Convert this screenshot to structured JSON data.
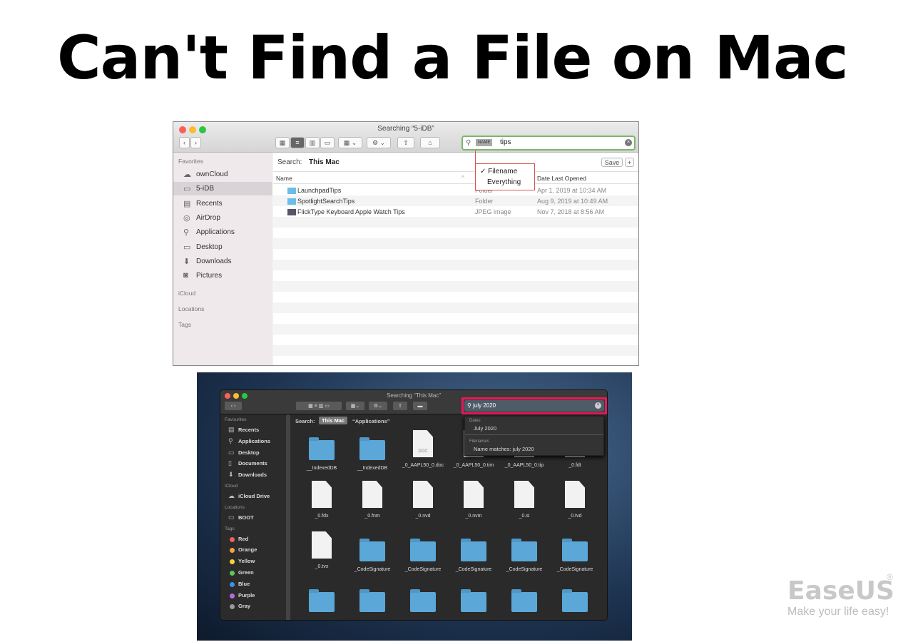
{
  "title": "Can't Find a File on Mac",
  "light": {
    "window_title": "Searching “5-iDB”",
    "search_token": "NAME",
    "search_text": "tips",
    "menu": [
      "✓ Filename",
      "Everything"
    ],
    "scope_label": "Search:",
    "scope": "This Mac",
    "save": "Save",
    "plus": "+",
    "col_name": "Name",
    "col_date": "Date Last Opened",
    "sidebar_headers": [
      "Favorites",
      "iCloud",
      "Locations",
      "Tags"
    ],
    "sidebar": [
      {
        "label": "ownCloud",
        "icon": "☁"
      },
      {
        "label": "5-iDB",
        "icon": "▭",
        "selected": true
      },
      {
        "label": "Recents",
        "icon": "▤"
      },
      {
        "label": "AirDrop",
        "icon": "◎"
      },
      {
        "label": "Applications",
        "icon": "⚲"
      },
      {
        "label": "Desktop",
        "icon": "▭"
      },
      {
        "label": "Downloads",
        "icon": "⬇"
      },
      {
        "label": "Pictures",
        "icon": "◙"
      }
    ],
    "rows": [
      {
        "name": "LaunchpadTips",
        "kind": "Folder",
        "date": "Apr 1, 2019 at 10:34 AM",
        "icon": "folder"
      },
      {
        "name": "SpotlightSearchTips",
        "kind": "Folder",
        "date": "Aug 9, 2019 at 10:49 AM",
        "icon": "folder"
      },
      {
        "name": "FlickType Keyboard Apple Watch Tips",
        "kind": "JPEG image",
        "date": "Nov 7, 2018 at 8:56 AM",
        "icon": "image"
      }
    ],
    "accent": "#7cb86a",
    "highlight": "#d9534f"
  },
  "dark": {
    "window_title": "Searching “This Mac”",
    "search_text": "july 2020",
    "scope_label": "Search:",
    "scope": "This Mac",
    "scope_alt": "“Applications”",
    "suggest": {
      "dates_header": "Dates",
      "dates_item": "July 2020",
      "files_header": "Filenames",
      "files_item": "Name matches: july 2020"
    },
    "sidebar_headers": [
      "Favourites",
      "iCloud",
      "Locations",
      "Tags"
    ],
    "favourites": [
      "Recents",
      "Applications",
      "Desktop",
      "Documents",
      "Downloads"
    ],
    "icloud": [
      "iCloud Drive"
    ],
    "locations": [
      "BOOT"
    ],
    "tags": [
      {
        "label": "Red",
        "color": "#f0605a"
      },
      {
        "label": "Orange",
        "color": "#f5a33a"
      },
      {
        "label": "Yellow",
        "color": "#f2d43a"
      },
      {
        "label": "Green",
        "color": "#5cc754"
      },
      {
        "label": "Blue",
        "color": "#3b8ff0"
      },
      {
        "label": "Purple",
        "color": "#b86ad8"
      },
      {
        "label": "Gray",
        "color": "#9a9a9a"
      }
    ],
    "grid": [
      {
        "label": "__IndexedDB",
        "type": "folder"
      },
      {
        "label": "__IndexedDB",
        "type": "folder"
      },
      {
        "label": "_0_AAPL50_0.doc",
        "type": "doc",
        "badge": "DOC"
      },
      {
        "label": "_0_AAPL50_0.tim",
        "type": "file"
      },
      {
        "label": "_0_AAPL50_0.tip",
        "type": "file"
      },
      {
        "label": "_0.fdt",
        "type": "file"
      },
      {
        "label": "_0.fdx",
        "type": "file"
      },
      {
        "label": "_0.fnm",
        "type": "file"
      },
      {
        "label": "_0.nvd",
        "type": "file"
      },
      {
        "label": "_0.nvm",
        "type": "file"
      },
      {
        "label": "_0.si",
        "type": "file"
      },
      {
        "label": "_0.tvd",
        "type": "file"
      },
      {
        "label": "_0.tvx",
        "type": "file"
      },
      {
        "label": "_CodeSignature",
        "type": "folder"
      },
      {
        "label": "_CodeSignature",
        "type": "folder"
      },
      {
        "label": "_CodeSignature",
        "type": "folder"
      },
      {
        "label": "_CodeSignature",
        "type": "folder"
      },
      {
        "label": "_CodeSignature",
        "type": "folder"
      },
      {
        "label": "",
        "type": "folder"
      },
      {
        "label": "",
        "type": "folder"
      },
      {
        "label": "",
        "type": "folder"
      },
      {
        "label": "",
        "type": "folder"
      },
      {
        "label": "",
        "type": "folder"
      },
      {
        "label": "",
        "type": "folder"
      }
    ],
    "highlight": "#e8185a"
  },
  "logo": {
    "brand": "EaseUS",
    "registered": "®",
    "tagline": "Make your life easy!"
  }
}
